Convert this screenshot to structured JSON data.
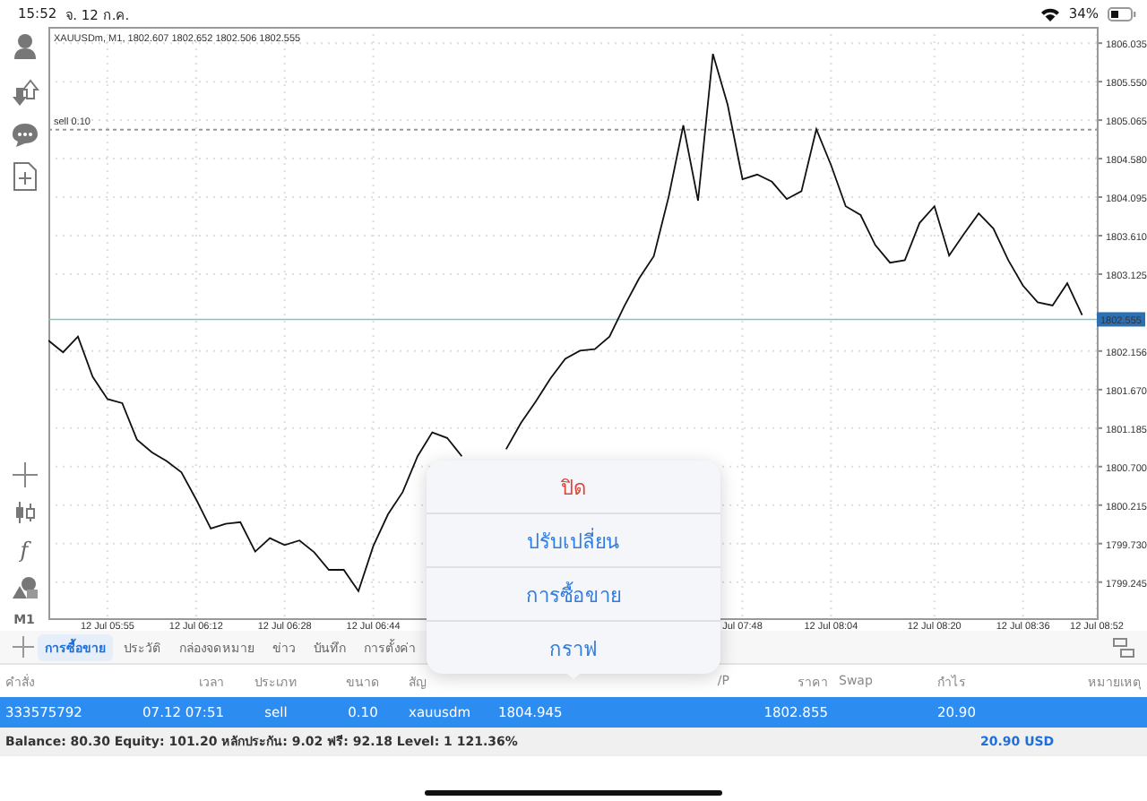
{
  "status_bar": {
    "time": "15:52",
    "date": "จ. 12 ก.ค.",
    "battery_text": "34%"
  },
  "left_toolbar": {
    "function_label": "f",
    "timeframe": "M1"
  },
  "chart": {
    "chart_data": {
      "type": "line",
      "title": "XAUUSDm, M1, 1802.607 1802.652 1802.506 1802.555",
      "categories": [
        null,
        null,
        null,
        null,
        "12 Jul 05:55",
        null,
        null,
        null,
        null,
        null,
        "12 Jul 06:12",
        null,
        null,
        null,
        null,
        null,
        "12 Jul 06:28",
        null,
        null,
        null,
        null,
        null,
        "12 Jul 06:44",
        null,
        null,
        null,
        null,
        null,
        null,
        null,
        null,
        null,
        null,
        null,
        null,
        null,
        null,
        null,
        null,
        null,
        null,
        null,
        null,
        null,
        null,
        null,
        null,
        "Jul 07:48",
        null,
        null,
        null,
        null,
        null,
        "12 Jul 08:04",
        null,
        null,
        null,
        null,
        null,
        null,
        "12 Jul 08:20",
        null,
        null,
        null,
        null,
        null,
        "12 Jul 08:36",
        null,
        null,
        null,
        null,
        "12 Jul 08:52"
      ],
      "series": [
        {
          "color": "#111111",
          "values": [
            1802.29,
            1802.14,
            1802.34,
            1801.83,
            1801.55,
            1801.5,
            1801.04,
            1800.88,
            1800.77,
            1800.63,
            1800.29,
            1799.92,
            1799.98,
            1800.0,
            1799.63,
            1799.8,
            1799.71,
            1799.77,
            1799.62,
            1799.4,
            1799.4,
            1799.13,
            1799.7,
            1800.1,
            1800.38,
            1800.83,
            1801.13,
            1801.06,
            1800.83,
            null,
            null,
            1800.92,
            1801.25,
            1801.52,
            1801.81,
            1802.06,
            1802.16,
            1802.18,
            1802.34,
            1802.72,
            1803.07,
            1803.35,
            1804.1,
            1805.0,
            1804.05,
            1805.9,
            1805.26,
            1804.32,
            1804.38,
            1804.29,
            1804.07,
            1804.17,
            1804.95,
            1804.5,
            1803.98,
            1803.87,
            1803.49,
            1803.27,
            1803.3,
            1803.77,
            1803.98,
            1803.36,
            1803.63,
            1803.89,
            1803.7,
            1803.3,
            1802.98,
            1802.77,
            1802.73,
            1803.01,
            1802.61,
            null
          ]
        }
      ],
      "ylim": [
        1798.79,
        1806.24
      ],
      "yticks": [
        {
          "value": 1806.035,
          "label": "1806.035"
        },
        {
          "value": 1805.55,
          "label": "1805.550"
        },
        {
          "value": 1805.065,
          "label": "1805.065"
        },
        {
          "value": 1804.58,
          "label": "1804.580"
        },
        {
          "value": 1804.095,
          "label": "1804.095"
        },
        {
          "value": 1803.61,
          "label": "1803.610"
        },
        {
          "value": 1803.125,
          "label": "1803.125"
        },
        {
          "value": 1802.156,
          "label": "1802.156"
        },
        {
          "value": 1801.67,
          "label": "1801.670"
        },
        {
          "value": 1801.185,
          "label": "1801.185"
        },
        {
          "value": 1800.7,
          "label": "1800.700"
        },
        {
          "value": 1800.215,
          "label": "1800.215"
        },
        {
          "value": 1799.73,
          "label": "1799.730"
        },
        {
          "value": 1799.245,
          "label": "1799.245"
        }
      ],
      "grid": true,
      "ref_lines": [
        {
          "value": 1804.945,
          "label": "sell 0.10",
          "axis": "y"
        },
        {
          "value": 1802.555,
          "label": "1802.555",
          "axis": "y"
        }
      ]
    }
  },
  "popup_menu": [
    {
      "label": "ปิด",
      "kind": "destructive"
    },
    {
      "label": "ปรับเปลี่ยน",
      "kind": "default"
    },
    {
      "label": "การซื้อขาย",
      "kind": "default"
    },
    {
      "label": "กราฟ",
      "kind": "default"
    }
  ],
  "tabs": [
    {
      "label": "การซื้อขาย",
      "selected": true
    },
    {
      "label": "ประวัติ",
      "selected": false
    },
    {
      "label": "กล่องจดหมาย",
      "selected": false
    },
    {
      "label": "ข่าว",
      "selected": false
    },
    {
      "label": "บันทึก",
      "selected": false
    },
    {
      "label": "การตั้งค่า",
      "selected": false
    }
  ],
  "table": {
    "columns": [
      "คำสั่ง",
      "เวลา",
      "ประเภท",
      "ขนาด",
      "สัญ",
      "/P",
      "ราคา",
      "Swap",
      "กำไร",
      "หมายเหตุ"
    ],
    "rows": [
      {
        "order": "333575792",
        "time": "07.12 07:51",
        "type": "sell",
        "volume": "0.10",
        "symbol": "xauusdm",
        "open_price": "1804.945",
        "price": "1802.855",
        "profit": "20.90",
        "selected": true
      }
    ]
  },
  "summary": {
    "text": "Balance: 80.30 Equity: 101.20 หลักประกัน: 9.02 ฟรี: 92.18 Level: 1 121.36%",
    "total": "20.90 USD"
  }
}
